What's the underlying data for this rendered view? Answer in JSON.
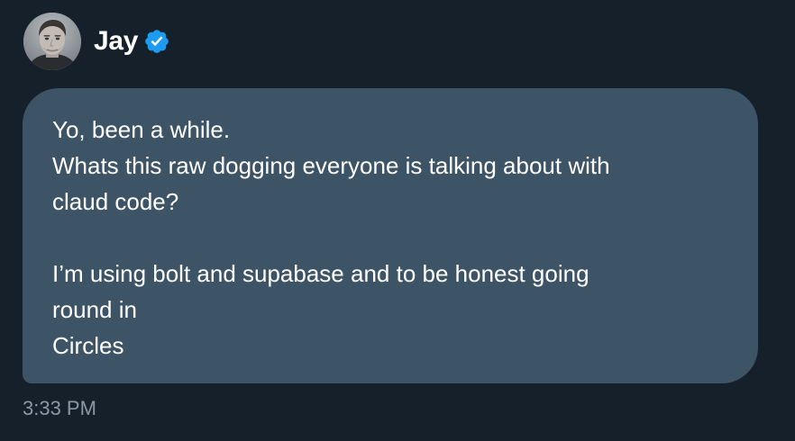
{
  "sender": {
    "name": "Jay",
    "verified_icon": "verified-badge-icon",
    "verified_color": "#1d9bf0",
    "avatar_icon": "avatar"
  },
  "message": {
    "lines": [
      "Yo, been a while.",
      "Whats this raw dogging everyone is talking about with",
      "claud code?",
      "",
      "I’m using bolt and supabase and to be honest going",
      "round in",
      "Circles"
    ],
    "timestamp": "3:33 PM"
  },
  "colors": {
    "background": "#15202b",
    "bubble": "#3d5466",
    "text": "#ffffff",
    "timestamp": "#8b98a5"
  }
}
